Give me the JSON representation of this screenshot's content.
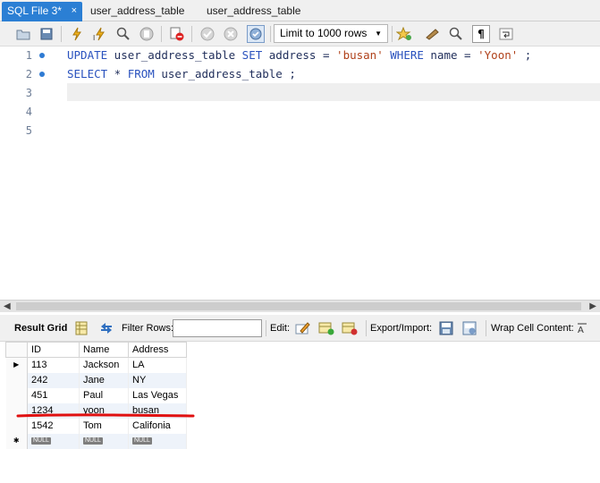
{
  "tabs": [
    {
      "label": "SQL File 3*",
      "close": "×",
      "active": true
    },
    {
      "label": "user_address_table",
      "active": false
    },
    {
      "label": "user_address_table",
      "active": false
    }
  ],
  "toolbar": {
    "limit_value": "Limit to 1000 rows",
    "icons": [
      "open-folder-icon",
      "save-icon",
      "execute-icon",
      "execute-current-icon",
      "explain-icon",
      "stop-icon",
      "toggle-error-icon",
      "commit-icon",
      "rollback-icon",
      "autocommit-icon",
      "limit-select",
      "add-snippet-icon",
      "beautify-icon",
      "find-icon",
      "invisible-chars-icon",
      "wrap-icon"
    ]
  },
  "editor": {
    "lines": [
      {
        "number": "1",
        "has_dot": true
      },
      {
        "number": "2",
        "has_dot": true
      },
      {
        "number": "3",
        "has_dot": false
      },
      {
        "number": "4",
        "has_dot": false
      },
      {
        "number": "5",
        "has_dot": false
      }
    ],
    "line1": {
      "kw_update": "UPDATE",
      "table": " user_address_table ",
      "kw_set": "SET",
      "assign": " address = ",
      "str_val": "'busan'",
      "sp1": " ",
      "kw_where": "WHERE",
      "cond": " name = ",
      "str_name": "'Yoon'",
      "end": " ;"
    },
    "line2": {
      "kw_select": "SELECT",
      "star": " * ",
      "kw_from": "FROM",
      "rest": " user_address_table ;"
    }
  },
  "result_toolbar": {
    "result_grid_label": "Result Grid",
    "filter_label": "Filter Rows:",
    "filter_value": "",
    "edit_label": "Edit:",
    "export_label": "Export/Import:",
    "wrap_label": "Wrap Cell Content:"
  },
  "grid": {
    "columns": [
      "ID",
      "Name",
      "Address"
    ],
    "rows": [
      {
        "id": "113",
        "name": "Jackson",
        "address": "LA",
        "marker": "▶"
      },
      {
        "id": "242",
        "name": "Jane",
        "address": "NY",
        "marker": ""
      },
      {
        "id": "451",
        "name": "Paul",
        "address": "Las Vegas",
        "marker": ""
      },
      {
        "id": "1234",
        "name": "yoon",
        "address": "busan",
        "marker": ""
      },
      {
        "id": "1542",
        "name": "Tom",
        "address": "Califonia",
        "marker": ""
      }
    ],
    "null_row": {
      "marker": "✱",
      "id": "NULL",
      "name": "NULL",
      "address": "NULL"
    }
  },
  "annotation_color": "#e01010"
}
